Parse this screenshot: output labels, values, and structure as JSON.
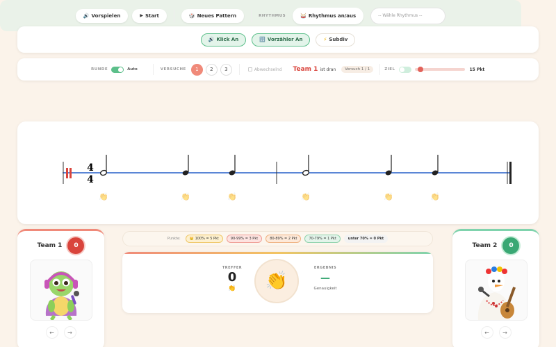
{
  "top_bar": {
    "buttons": [
      {
        "icon": "🔊",
        "label": "Klick An"
      },
      {
        "icon": "🔢",
        "label": "Vorzähler An"
      },
      {
        "icon": "⚡",
        "label": "Subdiv"
      }
    ]
  },
  "settings_bar": {
    "runde_label": "RUNDE",
    "auto_label": "Auto",
    "versuche_label": "VERSUCHE",
    "versuche_options": [
      "1",
      "2",
      "3"
    ],
    "active_versuch": "1",
    "abwechselnd_label": "Abwechselnd",
    "team_turn": "Team 1",
    "turn_suffix": "ist dran",
    "attempt_badge": "Versuch 1 / 1",
    "ziel_label": "ZIEL",
    "ziel_value": "15 Pkt",
    "ziel_slider_fraction": 0.05
  },
  "action_bar": {
    "vorspielen": {
      "icon": "🔊",
      "label": "Vorspielen"
    },
    "start": {
      "icon": "▶",
      "label": "Start"
    },
    "neues_pattern": {
      "icon": "🎲",
      "label": "Neues Pattern"
    },
    "rhythmus_label": "RHYTHMUS",
    "rhythmus_toggle": {
      "icon": "🥁",
      "label": "Rhythmus an/aus"
    },
    "rhythmus_select_placeholder": "-- Wähle Rhythmus --"
  },
  "staff": {
    "time_signature": [
      "4",
      "4"
    ],
    "measures": [
      [
        "half",
        "quarter",
        "quarter"
      ],
      [
        "half",
        "quarter",
        "quarter"
      ]
    ],
    "clap_icon": "👏"
  },
  "team1": {
    "name": "Team 1",
    "score": "0",
    "avatar": "turtle-singer",
    "prev_icon": "←",
    "next_icon": "→"
  },
  "team2": {
    "name": "Team 2",
    "score": "0",
    "avatar": "goose-guitarist",
    "prev_icon": "←",
    "next_icon": "→"
  },
  "points": {
    "label": "Punkte:",
    "chips": [
      {
        "text": "100% = 5 Pkt",
        "bg": "#fdf0cf",
        "border": "#efc767",
        "icon": "👑"
      },
      {
        "text": "90-99% = 3 Pkt",
        "bg": "#fde3e0",
        "border": "#ef9e95"
      },
      {
        "text": "80-89% = 2 Pkt",
        "bg": "#fde9d9",
        "border": "#efb281"
      },
      {
        "text": "70-79% = 1 Pkt",
        "bg": "#e3f4ea",
        "border": "#8fd2ac"
      },
      {
        "text": "unter 70% = 0 Pkt",
        "bg": "#f3f3f3",
        "border": "#f3f3f3"
      }
    ]
  },
  "result": {
    "treffer_label": "TREFFER",
    "treffer_value": "0",
    "treffer_icon": "👏",
    "center_icon": "👏",
    "ergebnis_label": "ERGEBNIS",
    "ergebnis_value": "—",
    "genauigkeit_label": "Genauigkeit"
  }
}
